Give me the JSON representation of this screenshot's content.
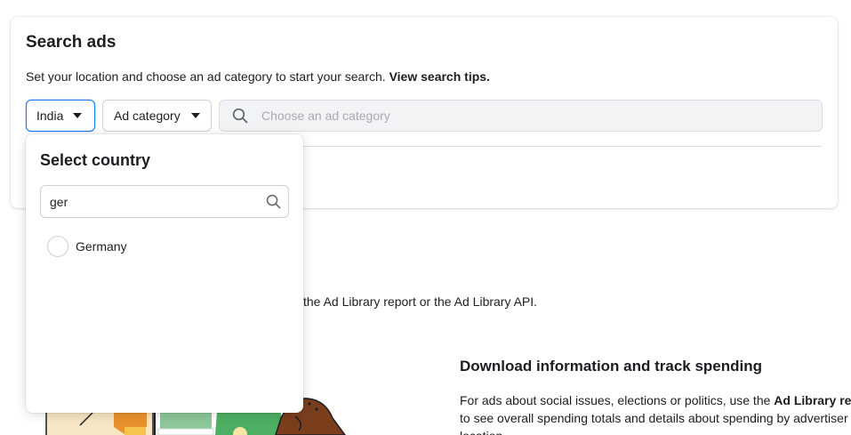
{
  "search_card": {
    "title": "Search ads",
    "subtitle": "Set your location and choose an ad category to start your search.",
    "tips_link": "View search tips.",
    "country_selector": {
      "value": "India"
    },
    "category_selector": {
      "value": "Ad category"
    },
    "search_input": {
      "placeholder": "Choose an ad category",
      "value": ""
    }
  },
  "country_dropdown": {
    "title": "Select country",
    "search_value": "ger",
    "options": [
      {
        "label": "Germany",
        "selected": false
      }
    ]
  },
  "background_content": {
    "partial_text": "the Ad Library report or the Ad Library API.",
    "section_title": "Download information and track spending",
    "section_line1_prefix": "For ads about social issues, elections or politics, use the",
    "section_line1_bold": "Ad Library rep",
    "section_line2": "to see overall spending totals and details about spending by advertiser",
    "section_line3": "location"
  },
  "colors": {
    "accent": "#1877f2",
    "text": "#1c1e21",
    "placeholder": "#a6abb2",
    "search_bg": "#f2f3f5",
    "border": "#ccd0d5"
  },
  "icons": {
    "caret": "caret-down-icon",
    "search": "search-icon",
    "radio": "radio-unchecked-icon"
  }
}
